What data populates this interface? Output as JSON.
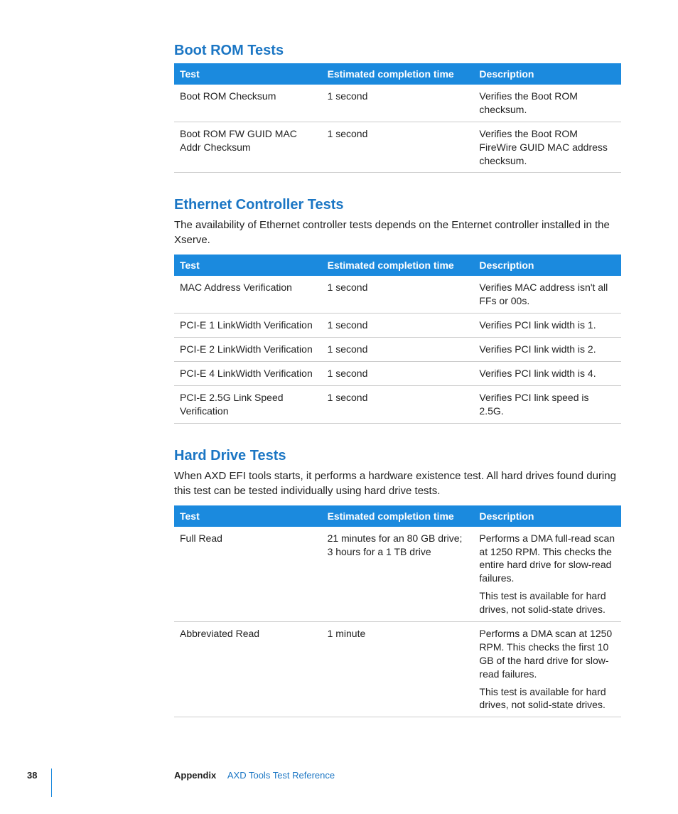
{
  "columns": {
    "test": "Test",
    "time": "Estimated completion time",
    "desc": "Description"
  },
  "sections": [
    {
      "title": "Boot ROM Tests",
      "intro": "",
      "rows": [
        {
          "test": "Boot ROM Checksum",
          "time": "1 second",
          "desc": [
            "Verifies the Boot ROM checksum."
          ]
        },
        {
          "test": "Boot ROM FW GUID MAC Addr Checksum",
          "time": "1 second",
          "desc": [
            "Verifies the Boot ROM FireWire GUID MAC address checksum."
          ]
        }
      ]
    },
    {
      "title": "Ethernet Controller Tests",
      "intro": "The availability of Ethernet controller tests depends on the Enternet controller installed in the Xserve.",
      "rows": [
        {
          "test": "MAC Address Verification",
          "time": "1 second",
          "desc": [
            "Verifies MAC address isn't all FFs or 00s."
          ]
        },
        {
          "test": "PCI-E 1 LinkWidth Verification",
          "time": "1 second",
          "desc": [
            "Verifies PCI link width is 1."
          ]
        },
        {
          "test": "PCI-E 2 LinkWidth Verification",
          "time": "1 second",
          "desc": [
            "Verifies PCI link width is 2."
          ]
        },
        {
          "test": "PCI-E 4 LinkWidth Verification",
          "time": "1 second",
          "desc": [
            "Verifies PCI link width is 4."
          ]
        },
        {
          "test": "PCI-E 2.5G Link Speed Verification",
          "time": "1 second",
          "desc": [
            "Verifies PCI link speed is 2.5G."
          ]
        }
      ]
    },
    {
      "title": "Hard Drive Tests",
      "intro": "When AXD EFI tools starts, it performs a hardware existence test. All hard drives found during this test can be tested individually using hard drive tests.",
      "rows": [
        {
          "test": "Full Read",
          "time": "21 minutes for an 80 GB drive; 3 hours for a 1 TB drive",
          "desc": [
            "Performs a DMA full-read scan at 1250 RPM. This checks the entire hard drive for slow-read failures.",
            "This test is available for hard drives, not solid-state drives."
          ]
        },
        {
          "test": "Abbreviated Read",
          "time": "1 minute",
          "desc": [
            "Performs a DMA scan at 1250 RPM. This checks the first 10 GB of the hard drive for slow-read failures.",
            "This test is available for hard drives, not solid-state drives."
          ]
        }
      ]
    }
  ],
  "footer": {
    "page": "38",
    "appendix": "Appendix",
    "ref": "AXD Tools Test Reference"
  }
}
